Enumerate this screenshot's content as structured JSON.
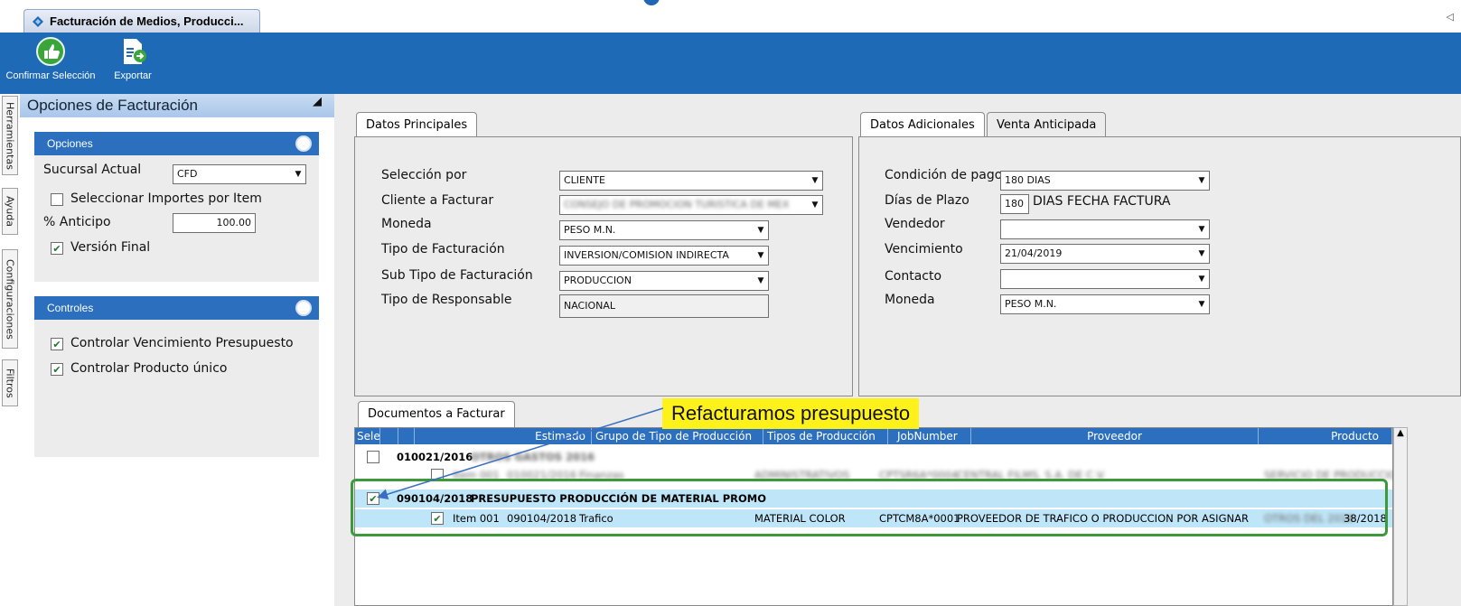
{
  "doc_tab": {
    "title": "Facturación de Medios, Producci..."
  },
  "ribbon": {
    "confirm_label": "Confirmar Selección",
    "export_label": "Exportar"
  },
  "side_tabs": [
    "Herramientas",
    "Ayuda",
    "Configuraciones",
    "Filtros"
  ],
  "left_panel": {
    "title": "Opciones de Facturación",
    "opciones": {
      "header": "Opciones",
      "sucursal_label": "Sucursal Actual",
      "sucursal_value": "CFD",
      "seleccionar_importes_label": "Seleccionar Importes por Item",
      "anticipo_label": "% Anticipo",
      "anticipo_value": "100.00",
      "version_final_label": "Versión Final"
    },
    "controles": {
      "header": "Controles",
      "vencimiento_label": "Controlar Vencimiento Presupuesto",
      "producto_label": "Controlar Producto único"
    }
  },
  "datos_principales": {
    "tab": "Datos Principales",
    "rows": [
      {
        "label": "Selección por",
        "value": "CLIENTE"
      },
      {
        "label": "Cliente a Facturar",
        "value": "CONSEJO DE PROMOCION TURISTICA DE MEX"
      },
      {
        "label": "Moneda",
        "value": "PESO M.N."
      },
      {
        "label": "Tipo de Facturación",
        "value": "INVERSION/COMISION INDIRECTA"
      },
      {
        "label": "Sub Tipo de Facturación",
        "value": "PRODUCCION"
      },
      {
        "label": "Tipo de Responsable",
        "value": "NACIONAL"
      }
    ]
  },
  "datos_adicionales": {
    "tab": "Datos Adicionales",
    "tab2": "Venta Anticipada",
    "condicion_label": "Condición de pago",
    "condicion_value": "180 DIAS",
    "dias_label": "Días de Plazo",
    "dias_value": "180",
    "dias_suffix": "DIAS FECHA FACTURA",
    "vendedor_label": "Vendedor",
    "vendedor_value": "",
    "vencimiento_label": "Vencimiento",
    "vencimiento_value": "21/04/2019",
    "contacto_label": "Contacto",
    "contacto_value": "",
    "moneda_label": "Moneda",
    "moneda_value": "PESO M.N."
  },
  "documentos": {
    "tab": "Documentos a Facturar",
    "columns": [
      "Selec",
      "Estimado",
      "Grupo de Tipo de Producción",
      "Tipos de Producción",
      "JobNumber",
      "Proveedor",
      "Producto"
    ],
    "rows": [
      {
        "doc": "010021/2016",
        "blurred_desc": "OTROS GASTOS 2016"
      },
      {
        "item": "Item 001",
        "estimado": "010021/2016",
        "grupo": "Finanzas",
        "tipos": "ADMINISTRATIVOS",
        "job": "CPTSR6A*0004",
        "proveedor": "CENTRAL FILMS, S.A. DE C.V.",
        "producto": "SERVICIO DE PRODUCCION"
      },
      {
        "doc": "090104/2018",
        "desc": "PRESUPUESTO PRODUCCIÓN DE MATERIAL PROMO"
      },
      {
        "item": "Item 001",
        "estimado": "090104/2018",
        "grupo": "Trafico",
        "tipos": "MATERIAL COLOR",
        "job": "CPTCM8A*0001",
        "proveedor": "PROVEEDOR DE TRAFICO O PRODUCCION POR ASIGNAR",
        "producto_blur": "OTROS DEL 2018",
        "producto_tail": "38/2018"
      }
    ]
  },
  "annotation": {
    "callout": "Refacturamos presupuesto"
  },
  "colors": {
    "ribbon": "#1f6ab7",
    "header_blue": "#2b6fbe",
    "selected_row": "#bfe6f8",
    "callout": "#fef21a",
    "highlight": "#3c9a3c"
  }
}
